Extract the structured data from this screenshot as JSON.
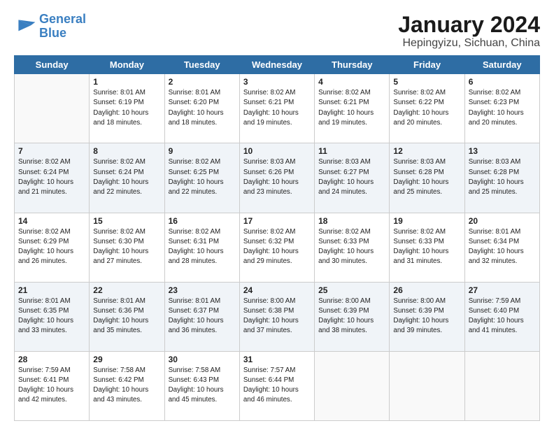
{
  "header": {
    "logo_line1": "General",
    "logo_line2": "Blue",
    "month_title": "January 2024",
    "location": "Hepingyizu, Sichuan, China"
  },
  "days_of_week": [
    "Sunday",
    "Monday",
    "Tuesday",
    "Wednesday",
    "Thursday",
    "Friday",
    "Saturday"
  ],
  "weeks": [
    [
      {
        "day": "",
        "content": ""
      },
      {
        "day": "1",
        "content": "Sunrise: 8:01 AM\nSunset: 6:19 PM\nDaylight: 10 hours\nand 18 minutes."
      },
      {
        "day": "2",
        "content": "Sunrise: 8:01 AM\nSunset: 6:20 PM\nDaylight: 10 hours\nand 18 minutes."
      },
      {
        "day": "3",
        "content": "Sunrise: 8:02 AM\nSunset: 6:21 PM\nDaylight: 10 hours\nand 19 minutes."
      },
      {
        "day": "4",
        "content": "Sunrise: 8:02 AM\nSunset: 6:21 PM\nDaylight: 10 hours\nand 19 minutes."
      },
      {
        "day": "5",
        "content": "Sunrise: 8:02 AM\nSunset: 6:22 PM\nDaylight: 10 hours\nand 20 minutes."
      },
      {
        "day": "6",
        "content": "Sunrise: 8:02 AM\nSunset: 6:23 PM\nDaylight: 10 hours\nand 20 minutes."
      }
    ],
    [
      {
        "day": "7",
        "content": "Sunrise: 8:02 AM\nSunset: 6:24 PM\nDaylight: 10 hours\nand 21 minutes."
      },
      {
        "day": "8",
        "content": "Sunrise: 8:02 AM\nSunset: 6:24 PM\nDaylight: 10 hours\nand 22 minutes."
      },
      {
        "day": "9",
        "content": "Sunrise: 8:02 AM\nSunset: 6:25 PM\nDaylight: 10 hours\nand 22 minutes."
      },
      {
        "day": "10",
        "content": "Sunrise: 8:03 AM\nSunset: 6:26 PM\nDaylight: 10 hours\nand 23 minutes."
      },
      {
        "day": "11",
        "content": "Sunrise: 8:03 AM\nSunset: 6:27 PM\nDaylight: 10 hours\nand 24 minutes."
      },
      {
        "day": "12",
        "content": "Sunrise: 8:03 AM\nSunset: 6:28 PM\nDaylight: 10 hours\nand 25 minutes."
      },
      {
        "day": "13",
        "content": "Sunrise: 8:03 AM\nSunset: 6:28 PM\nDaylight: 10 hours\nand 25 minutes."
      }
    ],
    [
      {
        "day": "14",
        "content": "Sunrise: 8:02 AM\nSunset: 6:29 PM\nDaylight: 10 hours\nand 26 minutes."
      },
      {
        "day": "15",
        "content": "Sunrise: 8:02 AM\nSunset: 6:30 PM\nDaylight: 10 hours\nand 27 minutes."
      },
      {
        "day": "16",
        "content": "Sunrise: 8:02 AM\nSunset: 6:31 PM\nDaylight: 10 hours\nand 28 minutes."
      },
      {
        "day": "17",
        "content": "Sunrise: 8:02 AM\nSunset: 6:32 PM\nDaylight: 10 hours\nand 29 minutes."
      },
      {
        "day": "18",
        "content": "Sunrise: 8:02 AM\nSunset: 6:33 PM\nDaylight: 10 hours\nand 30 minutes."
      },
      {
        "day": "19",
        "content": "Sunrise: 8:02 AM\nSunset: 6:33 PM\nDaylight: 10 hours\nand 31 minutes."
      },
      {
        "day": "20",
        "content": "Sunrise: 8:01 AM\nSunset: 6:34 PM\nDaylight: 10 hours\nand 32 minutes."
      }
    ],
    [
      {
        "day": "21",
        "content": "Sunrise: 8:01 AM\nSunset: 6:35 PM\nDaylight: 10 hours\nand 33 minutes."
      },
      {
        "day": "22",
        "content": "Sunrise: 8:01 AM\nSunset: 6:36 PM\nDaylight: 10 hours\nand 35 minutes."
      },
      {
        "day": "23",
        "content": "Sunrise: 8:01 AM\nSunset: 6:37 PM\nDaylight: 10 hours\nand 36 minutes."
      },
      {
        "day": "24",
        "content": "Sunrise: 8:00 AM\nSunset: 6:38 PM\nDaylight: 10 hours\nand 37 minutes."
      },
      {
        "day": "25",
        "content": "Sunrise: 8:00 AM\nSunset: 6:39 PM\nDaylight: 10 hours\nand 38 minutes."
      },
      {
        "day": "26",
        "content": "Sunrise: 8:00 AM\nSunset: 6:39 PM\nDaylight: 10 hours\nand 39 minutes."
      },
      {
        "day": "27",
        "content": "Sunrise: 7:59 AM\nSunset: 6:40 PM\nDaylight: 10 hours\nand 41 minutes."
      }
    ],
    [
      {
        "day": "28",
        "content": "Sunrise: 7:59 AM\nSunset: 6:41 PM\nDaylight: 10 hours\nand 42 minutes."
      },
      {
        "day": "29",
        "content": "Sunrise: 7:58 AM\nSunset: 6:42 PM\nDaylight: 10 hours\nand 43 minutes."
      },
      {
        "day": "30",
        "content": "Sunrise: 7:58 AM\nSunset: 6:43 PM\nDaylight: 10 hours\nand 45 minutes."
      },
      {
        "day": "31",
        "content": "Sunrise: 7:57 AM\nSunset: 6:44 PM\nDaylight: 10 hours\nand 46 minutes."
      },
      {
        "day": "",
        "content": ""
      },
      {
        "day": "",
        "content": ""
      },
      {
        "day": "",
        "content": ""
      }
    ]
  ]
}
